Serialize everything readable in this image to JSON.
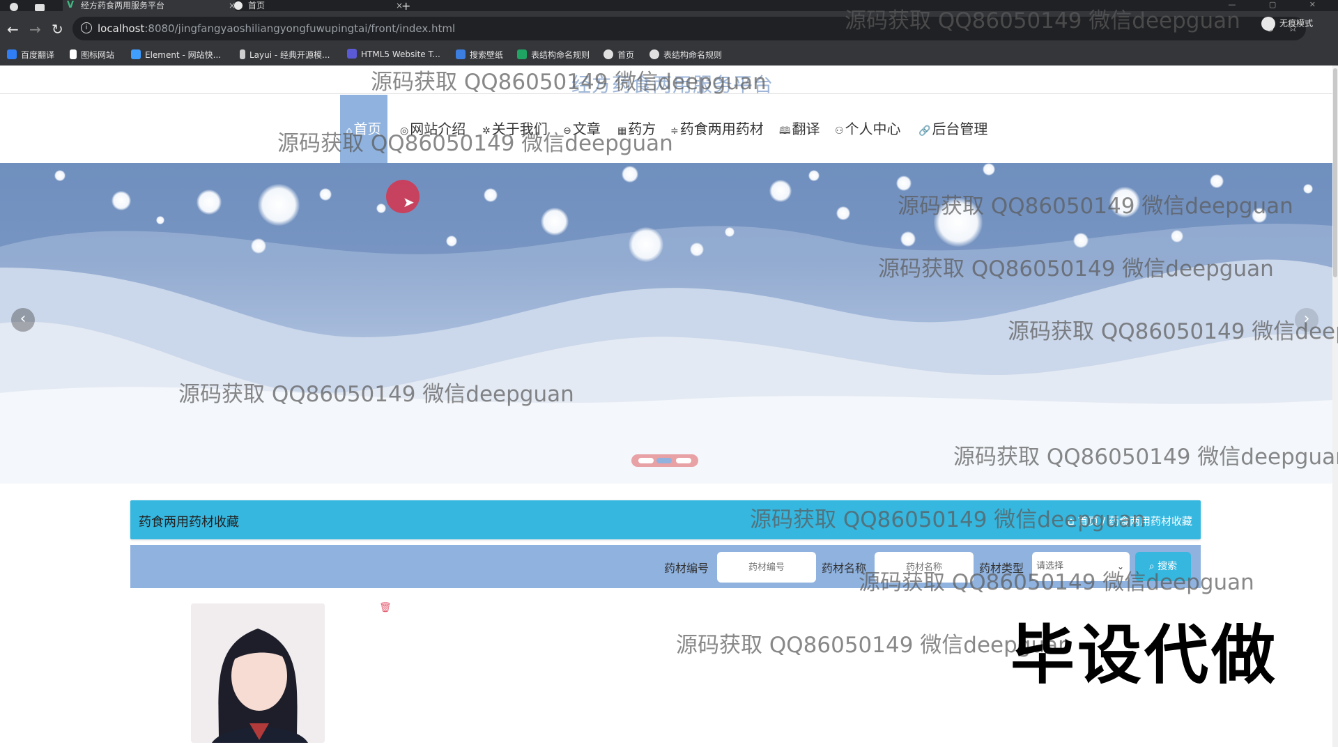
{
  "browser": {
    "tabs": [
      {
        "label": "经方药食两用服务平台",
        "close": "×"
      },
      {
        "label": "首页",
        "close": "×"
      }
    ],
    "new_tab": "+",
    "url_host": "localhost",
    "url_rest": ":8080/jingfangyaoshiliangyongfuwupingtai/front/index.html",
    "incognito_label": "无痕模式",
    "bookmarks": [
      {
        "label": "百度翻译",
        "color": "#2f7ef5"
      },
      {
        "label": "图标网站",
        "color": "#ffffff"
      },
      {
        "label": "Element - 网站快...",
        "color": "#409eff"
      },
      {
        "label": "Layui - 经典开源模...",
        "color": "#e0e0e0"
      },
      {
        "label": "HTML5 Website T...",
        "color": "#5a5ad6"
      },
      {
        "label": "搜索壁纸",
        "color": "#3c7de0"
      },
      {
        "label": "表结构命名规则",
        "color": "#1fa463"
      },
      {
        "label": "首页",
        "color": "#e0e0e0"
      },
      {
        "label": "表结构命名规则",
        "color": "#e0e0e0"
      }
    ]
  },
  "site": {
    "title": "经方药食两用服务平台",
    "nav": [
      {
        "label": "首页",
        "icon": "home-icon",
        "glyph": "⌂"
      },
      {
        "label": "网站介绍",
        "icon": "info-icon",
        "glyph": "◎"
      },
      {
        "label": "关于我们",
        "icon": "gear-icon",
        "glyph": "✲"
      },
      {
        "label": "文章",
        "icon": "article-icon",
        "glyph": "⊖"
      },
      {
        "label": "药方",
        "icon": "grid-icon",
        "glyph": "▦"
      },
      {
        "label": "药食两用药材",
        "icon": "sliders-icon",
        "glyph": "≑"
      },
      {
        "label": "翻译",
        "icon": "book-icon",
        "glyph": "🕮"
      },
      {
        "label": "个人中心",
        "icon": "user-icon",
        "glyph": "⚇"
      },
      {
        "label": "后台管理",
        "icon": "link-icon",
        "glyph": "🔗"
      }
    ]
  },
  "banner": {
    "prev_glyph": "‹",
    "next_glyph": "›"
  },
  "collection": {
    "title": "药食两用药材收藏",
    "breadcrumb": "⌂ 首页 / 药食两用药材收藏"
  },
  "search": {
    "fields": [
      {
        "label": "药材编号",
        "placeholder": "药材编号"
      },
      {
        "label": "药材名称",
        "placeholder": "药材名称"
      }
    ],
    "type_label": "药材类型",
    "type_value": "请选择",
    "button_label": "搜索",
    "button_icon": "search-icon"
  },
  "overlays": {
    "watermark": "源码获取 QQ86050149 微信deepguan",
    "ad_text": "毕设代做"
  }
}
